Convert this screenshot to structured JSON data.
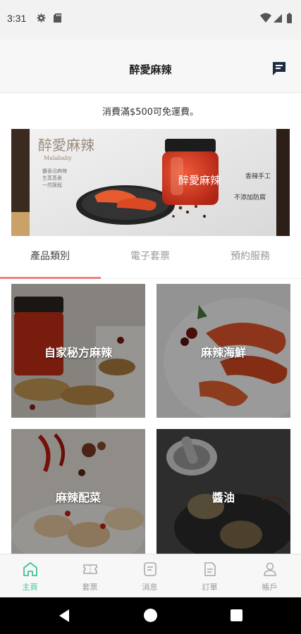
{
  "status_bar": {
    "time": "3:31"
  },
  "header": {
    "title": "醉愛麻辣",
    "chat_icon": "chat-icon"
  },
  "notice": "消費滿$500可免運費。",
  "banner": {
    "brand_text": "醉愛麻辣",
    "brand_sub": "Malababy",
    "vertical_left": [
      "醬香沿麻辣",
      "生蒸蒸煮",
      "一然匯程"
    ],
    "vertical_right": [
      "香辣手工",
      "不添加防腐"
    ],
    "jar_label": "醉愛麻辣"
  },
  "tabs": [
    {
      "label": "產品類別",
      "active": true
    },
    {
      "label": "電子套票",
      "active": false
    },
    {
      "label": "預約服務",
      "active": false
    }
  ],
  "categories": [
    {
      "label": "自家秘方麻辣"
    },
    {
      "label": "麻辣海鮮"
    },
    {
      "label": "麻辣配菜"
    },
    {
      "label": "醬油"
    }
  ],
  "bottom_nav": [
    {
      "label": "主頁",
      "icon": "home-icon",
      "active": true
    },
    {
      "label": "套票",
      "icon": "ticket-icon",
      "active": false
    },
    {
      "label": "消息",
      "icon": "message-icon",
      "active": false
    },
    {
      "label": "訂單",
      "icon": "order-icon",
      "active": false
    },
    {
      "label": "帳戶",
      "icon": "account-icon",
      "active": false
    }
  ],
  "colors": {
    "accent_green": "#3cc58f",
    "tab_indicator": "#f08080",
    "header_icon": "#1f2a44"
  }
}
